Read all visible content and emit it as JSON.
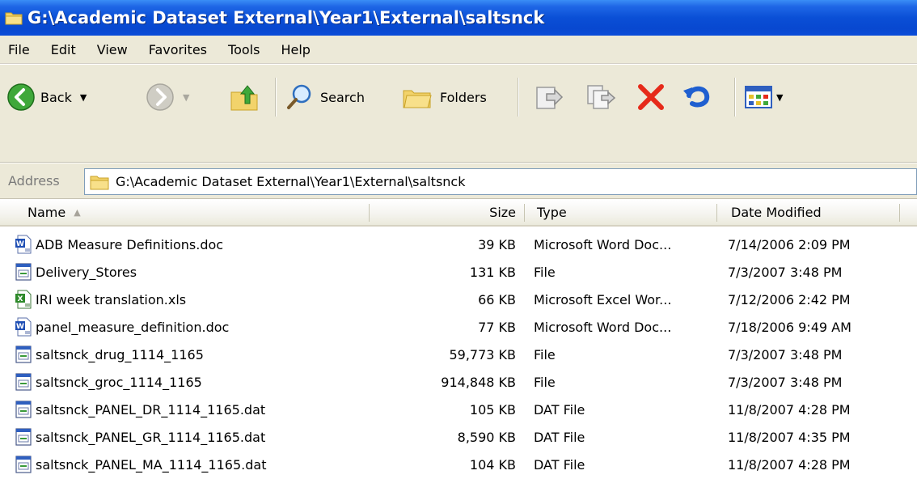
{
  "window": {
    "title": "G:\\Academic Dataset External\\Year1\\External\\saltsnck"
  },
  "menu": [
    "File",
    "Edit",
    "View",
    "Favorites",
    "Tools",
    "Help"
  ],
  "toolbar": {
    "back_label": "Back",
    "search_label": "Search",
    "folders_label": "Folders"
  },
  "address": {
    "label": "Address",
    "value": "G:\\Academic Dataset External\\Year1\\External\\saltsnck"
  },
  "columns": {
    "name": "Name",
    "size": "Size",
    "type": "Type",
    "date": "Date Modified"
  },
  "files": [
    {
      "name": "ADB Measure Definitions.doc",
      "size": "39 KB",
      "type": "Microsoft Word Doc...",
      "date": "7/14/2006 2:09 PM",
      "icon": "word-doc-icon"
    },
    {
      "name": "Delivery_Stores",
      "size": "131 KB",
      "type": "File",
      "date": "7/3/2007 3:48 PM",
      "icon": "generic-file-icon"
    },
    {
      "name": "IRI week translation.xls",
      "size": "66 KB",
      "type": "Microsoft Excel Wor...",
      "date": "7/12/2006 2:42 PM",
      "icon": "excel-sheet-icon"
    },
    {
      "name": "panel_measure_definition.doc",
      "size": "77 KB",
      "type": "Microsoft Word Doc...",
      "date": "7/18/2006 9:49 AM",
      "icon": "word-doc-icon"
    },
    {
      "name": "saltsnck_drug_1114_1165",
      "size": "59,773 KB",
      "type": "File",
      "date": "7/3/2007 3:48 PM",
      "icon": "generic-file-icon"
    },
    {
      "name": "saltsnck_groc_1114_1165",
      "size": "914,848 KB",
      "type": "File",
      "date": "7/3/2007 3:48 PM",
      "icon": "generic-file-icon"
    },
    {
      "name": "saltsnck_PANEL_DR_1114_1165.dat",
      "size": "105 KB",
      "type": "DAT File",
      "date": "11/8/2007 4:28 PM",
      "icon": "generic-file-icon"
    },
    {
      "name": "saltsnck_PANEL_GR_1114_1165.dat",
      "size": "8,590 KB",
      "type": "DAT File",
      "date": "11/8/2007 4:35 PM",
      "icon": "generic-file-icon"
    },
    {
      "name": "saltsnck_PANEL_MA_1114_1165.dat",
      "size": "104 KB",
      "type": "DAT File",
      "date": "11/8/2007 4:28 PM",
      "icon": "generic-file-icon"
    }
  ]
}
